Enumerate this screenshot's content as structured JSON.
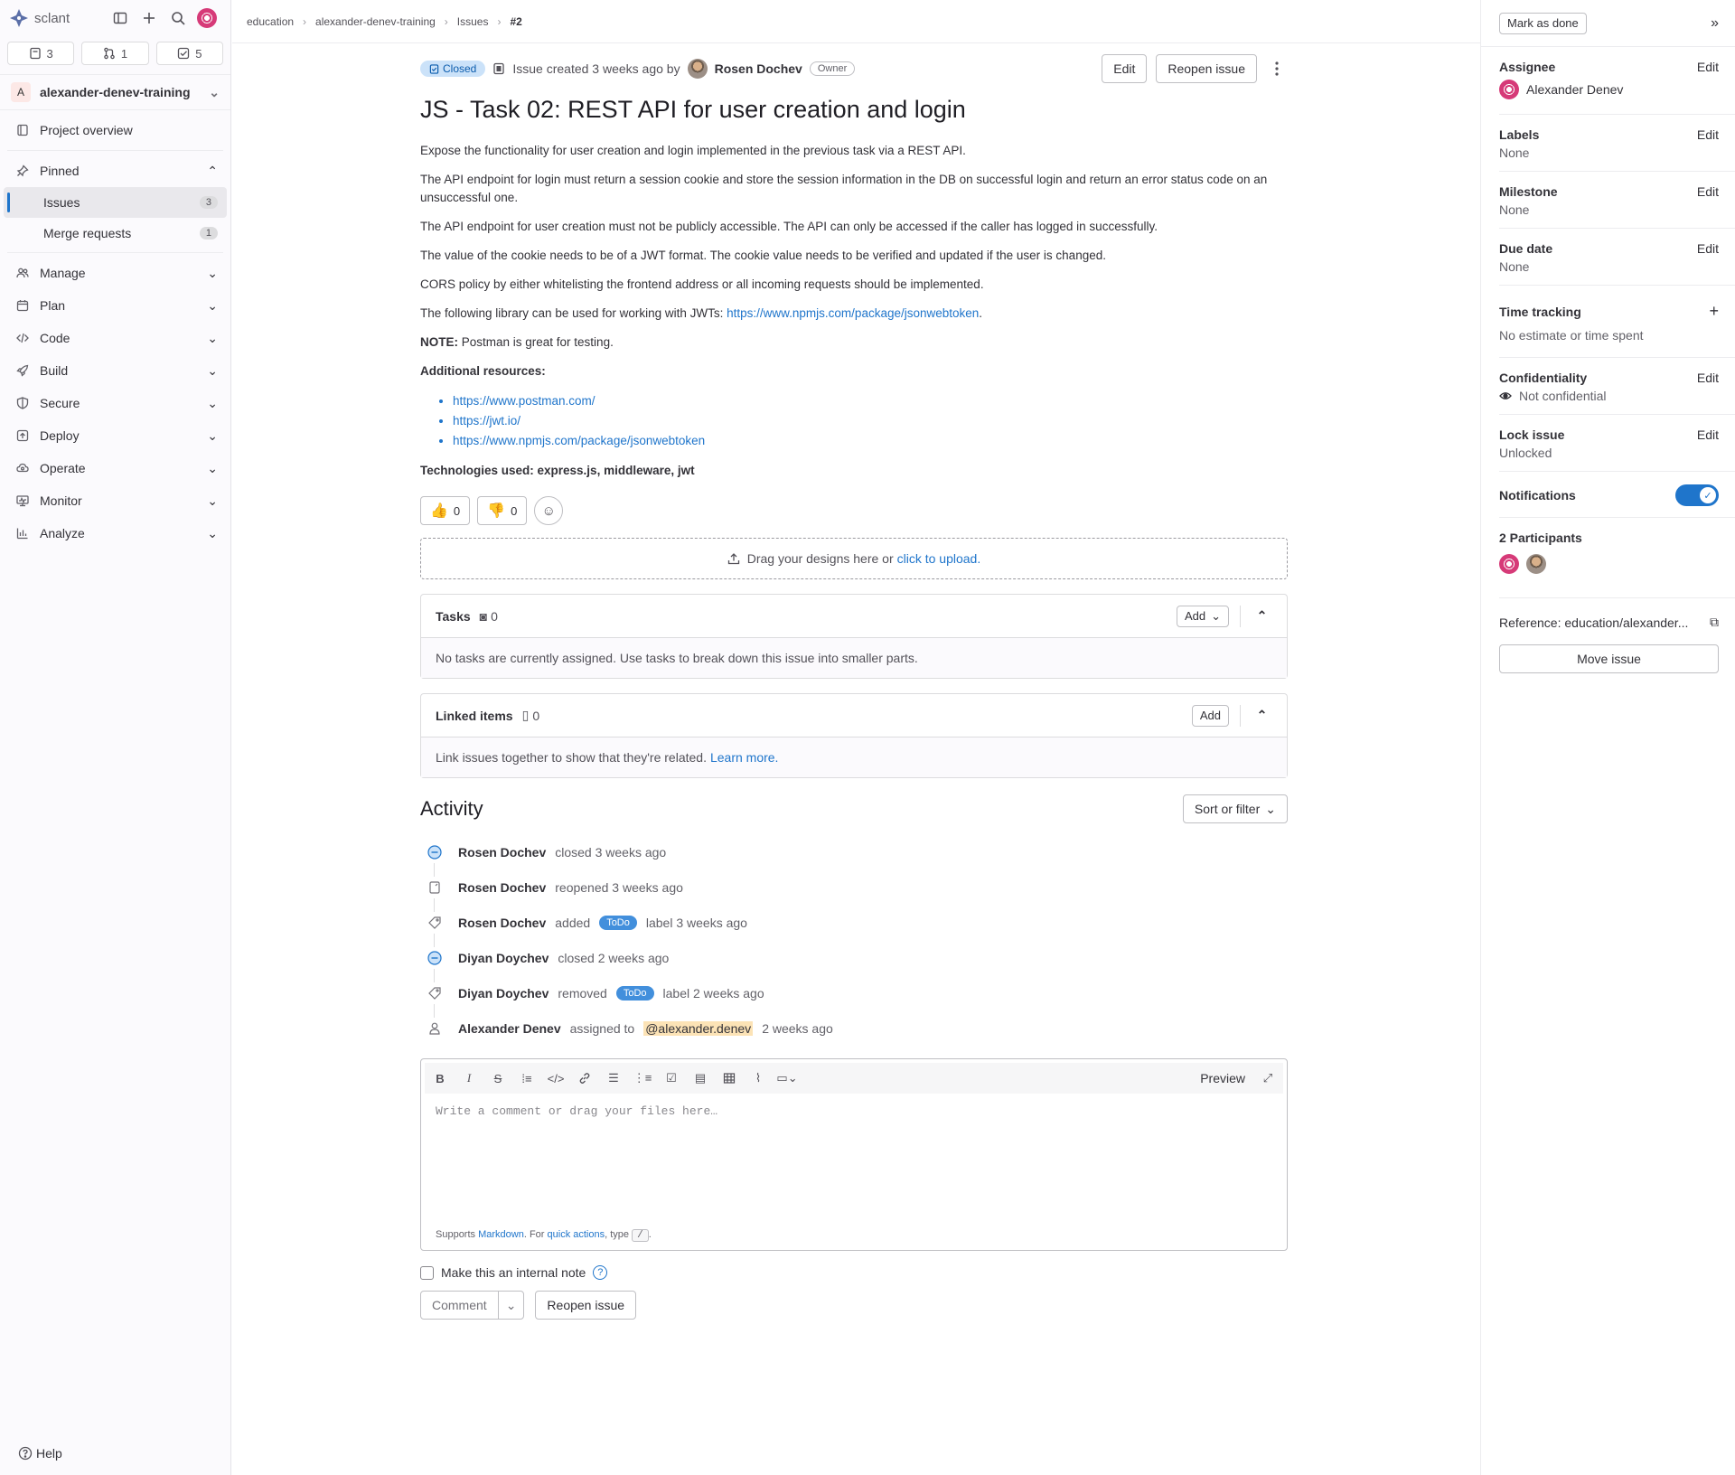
{
  "sidebar": {
    "brand": "sclant",
    "counts": {
      "issues": "3",
      "merge_requests": "1",
      "todos": "5"
    },
    "project_initial": "A",
    "project_name": "alexander-denev-training",
    "items": {
      "overview": "Project overview",
      "pinned": "Pinned",
      "issues": "Issues",
      "issues_count": "3",
      "merge_requests": "Merge requests",
      "merge_requests_count": "1",
      "manage": "Manage",
      "plan": "Plan",
      "code": "Code",
      "build": "Build",
      "secure": "Secure",
      "deploy": "Deploy",
      "operate": "Operate",
      "monitor": "Monitor",
      "analyze": "Analyze"
    },
    "help": "Help"
  },
  "breadcrumb": [
    "education",
    "alexander-denev-training",
    "Issues",
    "#2"
  ],
  "issue": {
    "status": "Closed",
    "created_text": "Issue created 3 weeks ago by",
    "author": "Rosen Dochev",
    "author_role": "Owner",
    "edit_label": "Edit",
    "reopen_label": "Reopen issue",
    "title": "JS - Task 02: REST API for user creation and login",
    "description": {
      "p1": "Expose the functionality for user creation and login implemented in the previous task via a REST API.",
      "p2": "The API endpoint for login must return a session cookie and store the session information in the DB on successful login and return an error status code on an unsuccessful one.",
      "p3": "The API endpoint for user creation must not be publicly accessible. The API can only be accessed if the caller has logged in successfully.",
      "p4": "The value of the cookie needs to be of a JWT format. The cookie value needs to be verified and updated if the user is changed.",
      "p5": "CORS policy by either whitelisting the frontend address or all incoming requests should be implemented.",
      "p6_text": "The following library can be used for working with JWTs: ",
      "p6_link": "https://www.npmjs.com/package/jsonwebtoken",
      "p6_end": ".",
      "note_label": "NOTE:",
      "note_text": " Postman is great for testing.",
      "resources_label": "Additional resources:",
      "links": [
        "https://www.postman.com/",
        "https://jwt.io/",
        "https://www.npmjs.com/package/jsonwebtoken"
      ],
      "tech": "Technologies used: express.js, middleware, jwt"
    },
    "reactions": {
      "thumbs_up": "0",
      "thumbs_down": "0"
    }
  },
  "dropzone": {
    "text": "Drag your designs here or ",
    "link": "click to upload."
  },
  "tasks": {
    "title": "Tasks",
    "count": "0",
    "add": "Add",
    "empty": "No tasks are currently assigned. Use tasks to break down this issue into smaller parts."
  },
  "linked": {
    "title": "Linked items",
    "count": "0",
    "add": "Add",
    "empty": "Link issues together to show that they're related. ",
    "learn_more": "Learn more."
  },
  "activity": {
    "title": "Activity",
    "sort_label": "Sort or filter",
    "events": [
      {
        "who": "Rosen Dochev",
        "text": "closed 3 weeks ago"
      },
      {
        "who": "Rosen Dochev",
        "text": "reopened 3 weeks ago"
      },
      {
        "who": "Rosen Dochev",
        "pre": "added",
        "label": "ToDo",
        "post": "label 3 weeks ago"
      },
      {
        "who": "Diyan Doychev",
        "text": "closed 2 weeks ago"
      },
      {
        "who": "Diyan Doychev",
        "pre": "removed",
        "label": "ToDo",
        "post": "label 2 weeks ago"
      },
      {
        "who": "Alexander Denev",
        "pre": "assigned to",
        "mention": "@alexander.denev",
        "post": "2 weeks ago"
      }
    ]
  },
  "editor": {
    "preview": "Preview",
    "placeholder": "Write a comment or drag your files here…",
    "hint_1": "Supports ",
    "hint_markdown": "Markdown",
    "hint_2": ". For ",
    "hint_quick": "quick actions",
    "hint_3": ", type ",
    "hint_key": "/",
    "hint_4": ".",
    "internal_note": "Make this an internal note",
    "comment": "Comment",
    "reopen": "Reopen issue"
  },
  "right_panel": {
    "mark_done": "Mark as done",
    "edit": "Edit",
    "assignee_label": "Assignee",
    "assignee": "Alexander Denev",
    "labels_label": "Labels",
    "labels": "None",
    "milestone_label": "Milestone",
    "milestone": "None",
    "due_label": "Due date",
    "due": "None",
    "time_label": "Time tracking",
    "time": "No estimate or time spent",
    "conf_label": "Confidentiality",
    "conf": "Not confidential",
    "lock_label": "Lock issue",
    "lock": "Unlocked",
    "notif_label": "Notifications",
    "participants_label": "2 Participants",
    "reference": "Reference: education/alexander...",
    "move": "Move issue"
  },
  "colors": {
    "accent": "#1f75cb",
    "closed_badge_bg": "#cbe2f9",
    "label_todo": "#428fdc",
    "mention_bg": "#fce3b6"
  }
}
